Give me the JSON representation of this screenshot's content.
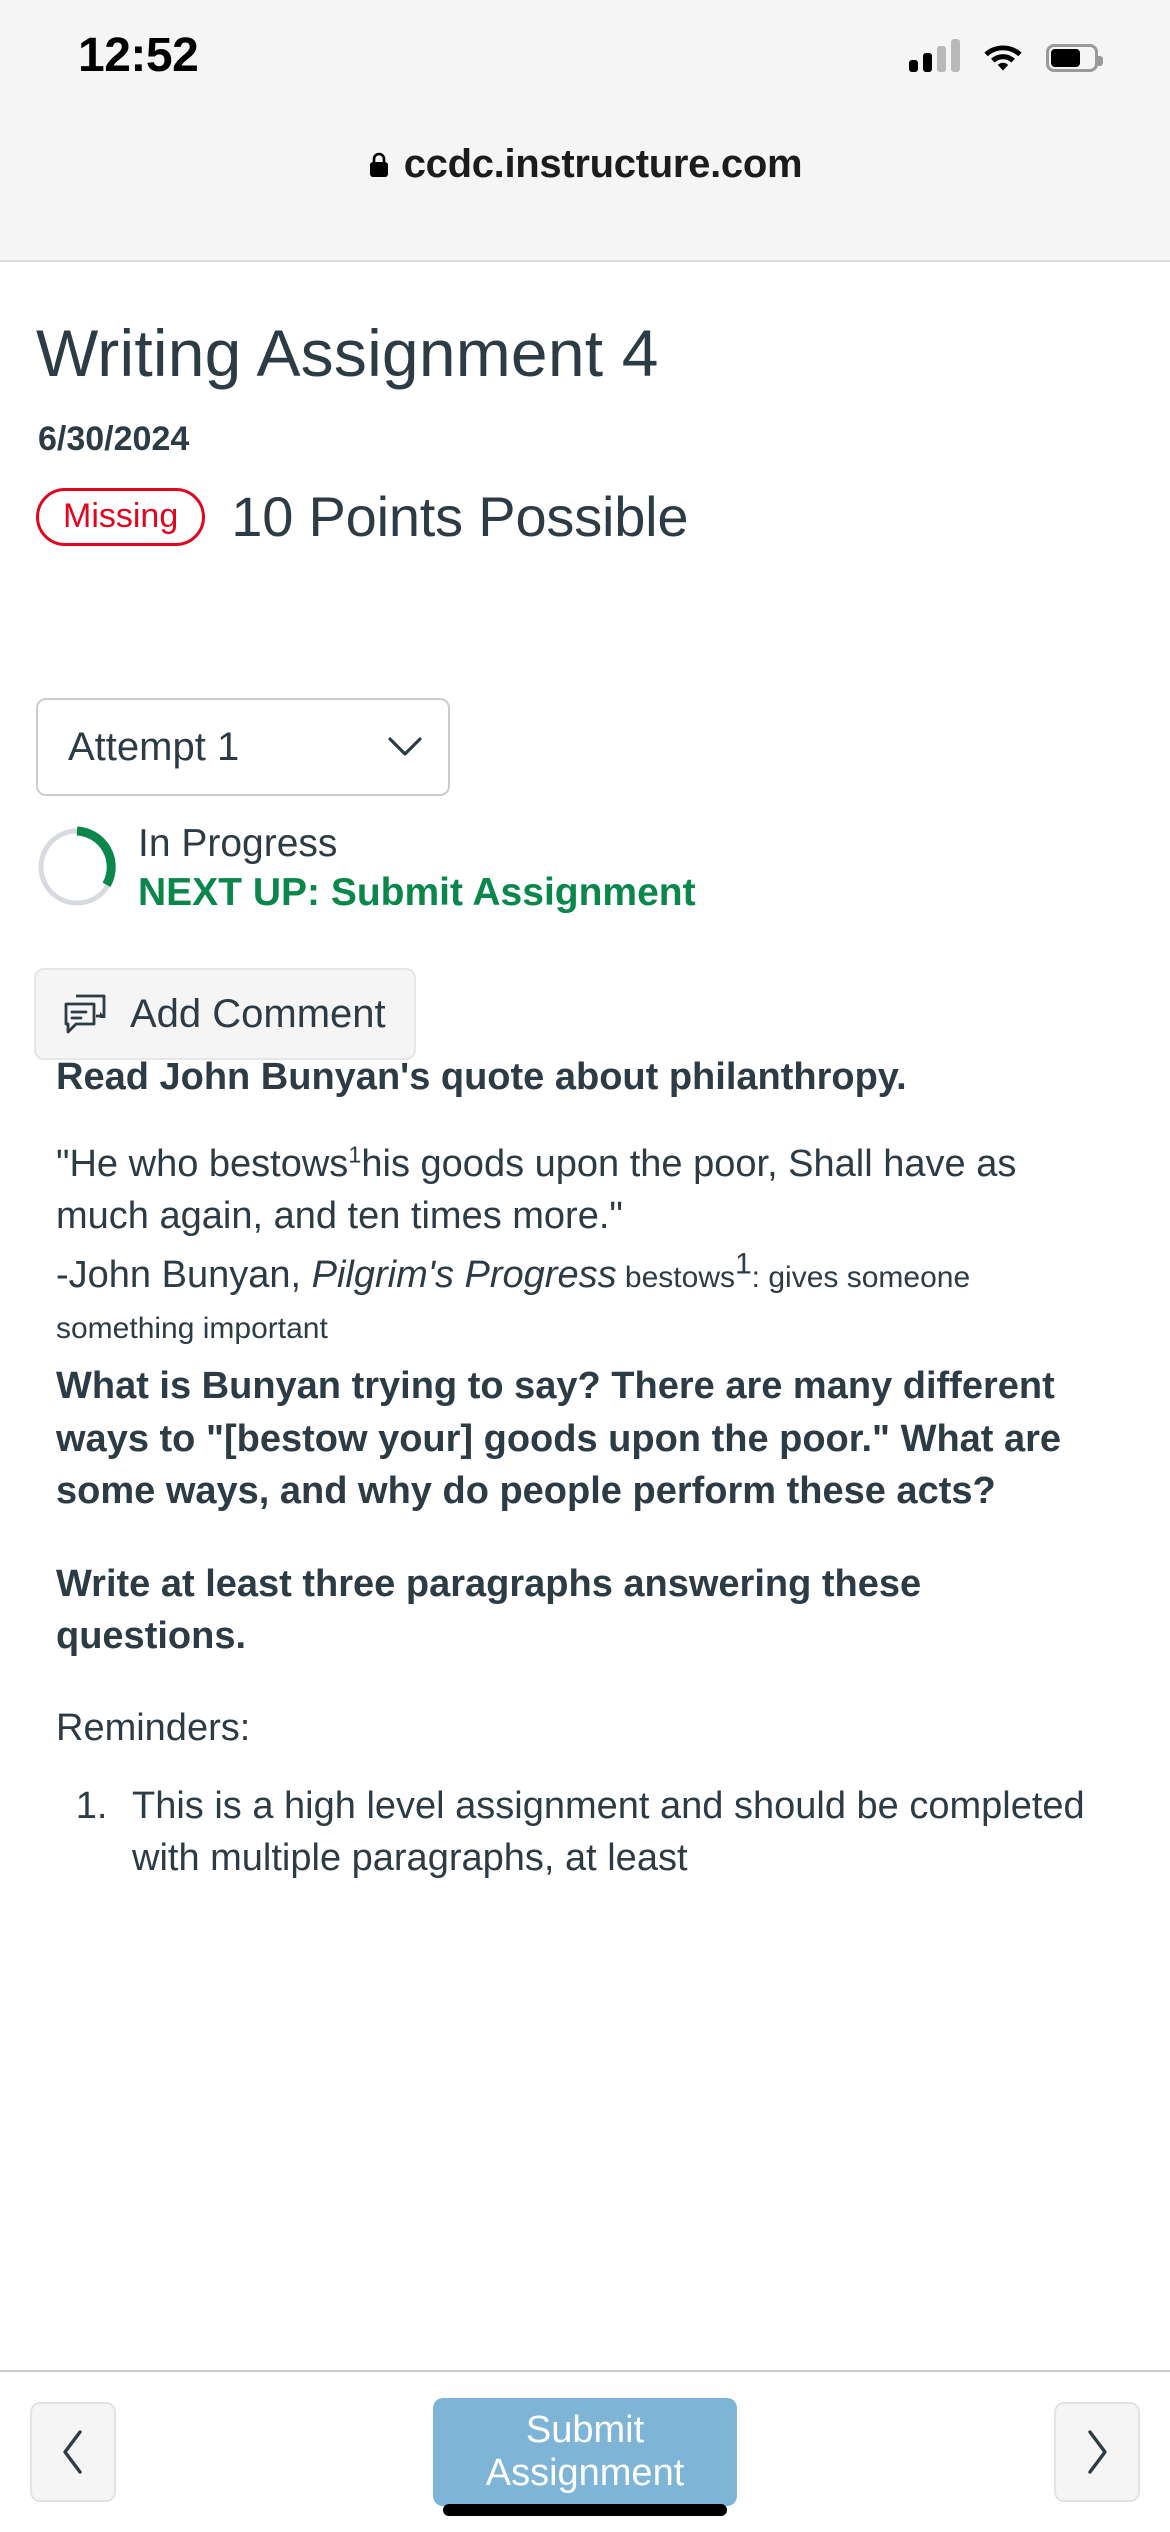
{
  "status_bar": {
    "time": "12:52",
    "signal_icon": "signal-bars-icon",
    "wifi_icon": "wifi-icon",
    "battery_icon": "battery-icon"
  },
  "browser": {
    "lock_icon": "lock-icon",
    "url": "ccdc.instructure.com"
  },
  "assignment": {
    "title": "Writing Assignment 4",
    "due_date": "6/30/2024",
    "status_badge": "Missing",
    "points_possible": "10 Points Possible",
    "attempt_label": "Attempt 1",
    "progress_status": "In Progress",
    "next_up": "NEXT UP: Submit Assignment",
    "add_comment_label": "Add Comment"
  },
  "description": {
    "heading": "Read John Bunyan's quote about philanthropy.",
    "quote_before_sup": "\"He who bestows",
    "quote_sup": "1",
    "quote_after_sup": "his goods upon the poor, Shall have as much again, and ten times more.\"",
    "attribution_prefix": "-John Bunyan, ",
    "attribution_title": "Pilgrim's Progress",
    "footnote_term": " bestows",
    "footnote_sup": "1",
    "footnote_definition": ": gives someone something important",
    "question_paragraph": "What is Bunyan trying to say? There are many different ways to \"[bestow your] goods upon the poor.\" What are some ways, and why do people perform these acts?",
    "instruction_paragraph": "Write at least three paragraphs answering these questions.",
    "reminders_label": "Reminders:",
    "reminders": [
      "This is a high level assignment and should be completed with multiple paragraphs, at least"
    ]
  },
  "bottom_bar": {
    "prev_icon": "chevron-left-icon",
    "next_icon": "chevron-right-icon",
    "submit_label": "Submit Assignment"
  },
  "colors": {
    "brand_text": "#2d3b45",
    "missing_red": "#e0061f",
    "progress_green": "#0b874b",
    "submit_blue": "#7eb5d6"
  }
}
